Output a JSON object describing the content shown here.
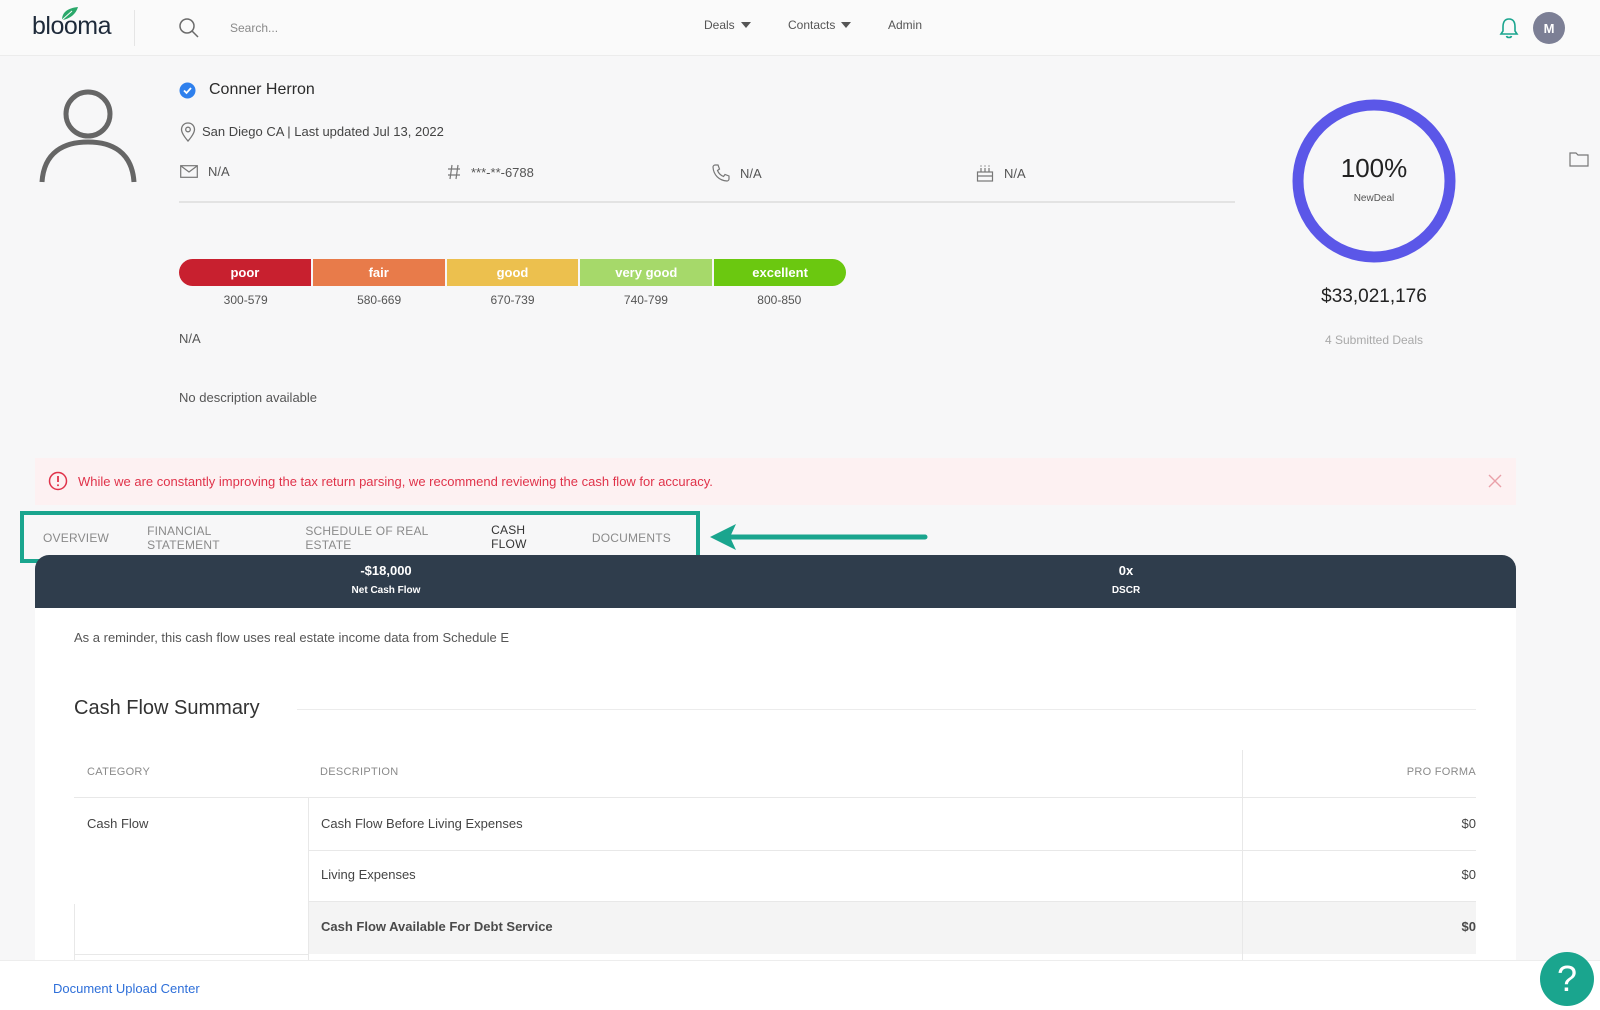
{
  "brand": {
    "logo_text": "blooma"
  },
  "nav": {
    "search_placeholder": "Search...",
    "links": [
      {
        "label": "Deals"
      },
      {
        "label": "Contacts"
      },
      {
        "label": "Admin"
      }
    ],
    "avatar_initial": "M"
  },
  "profile": {
    "name": "Conner Herron",
    "location": "San Diego CA | Last updated Jul 13, 2022",
    "email": "N/A",
    "tax_id": "***-**-6788",
    "phone": "N/A",
    "birthday": "N/A",
    "credit_score": "N/A",
    "description": "No description available"
  },
  "credit": {
    "segments": [
      {
        "label": "poor",
        "range": "300-579",
        "color": "#c8202f"
      },
      {
        "label": "fair",
        "range": "580-669",
        "color": "#e87b4a"
      },
      {
        "label": "good",
        "range": "670-739",
        "color": "#ecc04e"
      },
      {
        "label": "very good",
        "range": "740-799",
        "color": "#a6d96a"
      },
      {
        "label": "excellent",
        "range": "800-850",
        "color": "#6bc810"
      }
    ]
  },
  "deal_progress": {
    "percent_label": "100%",
    "percent_value": 100,
    "stage": "NewDeal",
    "amount": "$33,021,176",
    "submitted": "4 Submitted Deals",
    "ring_color": "#5b57e8"
  },
  "alert": {
    "text": "While we are constantly improving the tax return parsing, we recommend reviewing the cash flow for accuracy."
  },
  "tabs": [
    {
      "label": "OVERVIEW",
      "active": false
    },
    {
      "label": "FINANCIAL STATEMENT",
      "active": false
    },
    {
      "label": "SCHEDULE OF REAL ESTATE",
      "active": false
    },
    {
      "label": "CASH FLOW",
      "active": true
    },
    {
      "label": "DOCUMENTS",
      "active": false
    }
  ],
  "summary": {
    "net_cash_flow_value": "-$18,000",
    "net_cash_flow_label": "Net Cash Flow",
    "dscr_value": "0x",
    "dscr_label": "DSCR"
  },
  "cash_flow": {
    "reminder": "As a reminder, this cash flow uses real estate income data from Schedule E",
    "title": "Cash Flow Summary",
    "headers": {
      "category": "CATEGORY",
      "description": "DESCRIPTION",
      "pro_forma": "PRO FORMA"
    },
    "category": "Cash Flow",
    "rows": [
      {
        "description": "Cash Flow Before Living Expenses",
        "value": "$0"
      },
      {
        "description": "Living Expenses",
        "value": "$0"
      },
      {
        "description": "Cash Flow Available For Debt Service",
        "value": "$0"
      }
    ]
  },
  "footer": {
    "link": "Document Upload Center",
    "help": "?"
  },
  "colors": {
    "accent": "#1aa58e",
    "alert": "#e0334a",
    "dark_bar": "#2f3d4c"
  }
}
